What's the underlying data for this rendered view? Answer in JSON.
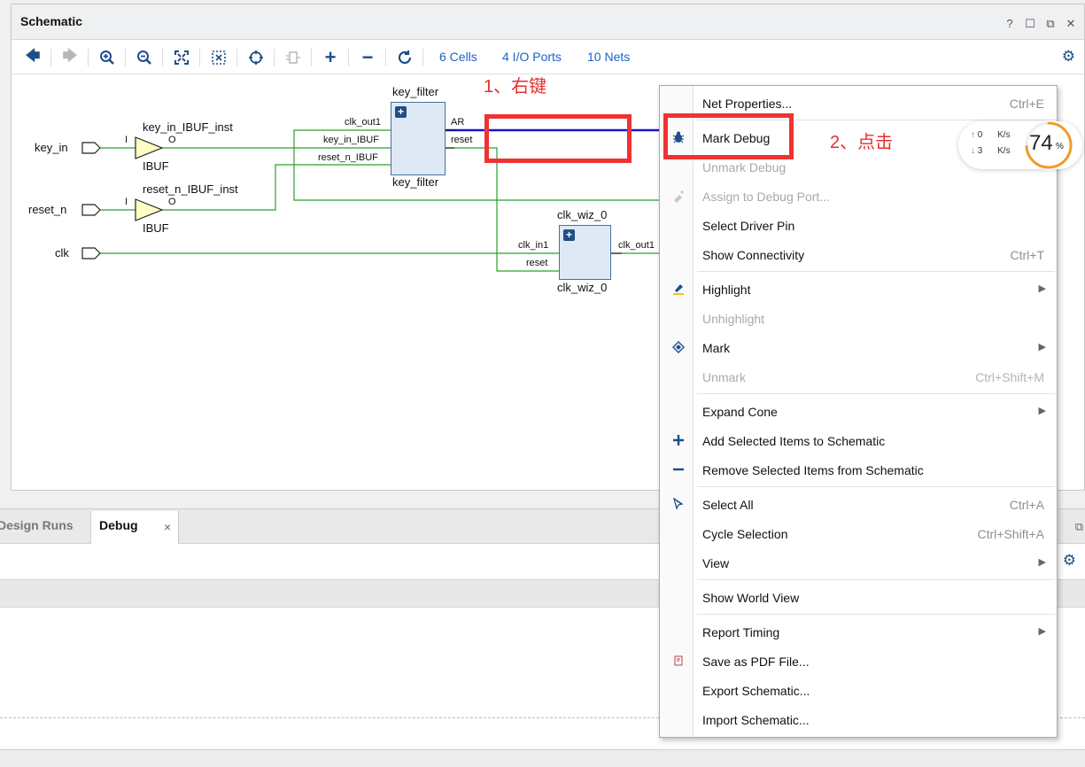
{
  "schematic": {
    "title": "Schematic",
    "links": {
      "cells": "6 Cells",
      "io_ports": "4 I/O Ports",
      "nets": "10 Nets"
    },
    "ports": [
      "key_in",
      "reset_n",
      "clk"
    ],
    "ibuf1": {
      "inst": "key_in_IBUF_inst",
      "type": "IBUF",
      "pin_i": "I",
      "pin_o": "O"
    },
    "ibuf2": {
      "inst": "reset_n_IBUF_inst",
      "type": "IBUF",
      "pin_i": "I",
      "pin_o": "O"
    },
    "key_filter": {
      "name_top": "key_filter",
      "name_bottom": "key_filter",
      "pins_in": [
        "clk_out1",
        "key_in_IBUF",
        "reset_n_IBUF"
      ],
      "pins_out": [
        "AR",
        "reset"
      ]
    },
    "clk_wiz": {
      "name_top": "clk_wiz_0",
      "name_bottom": "clk_wiz_0",
      "pins_in": [
        "clk_in1",
        "reset"
      ],
      "pin_out": "clk_out1"
    },
    "annotations": {
      "step1": "1、右键",
      "step2": "2、点击"
    }
  },
  "context_menu": {
    "items": [
      {
        "label": "Net Properties...",
        "shortcut": "Ctrl+E",
        "disabled": false,
        "icon": ""
      },
      {
        "label": "Mark Debug",
        "shortcut": "",
        "disabled": false,
        "icon": "bug-icon"
      },
      {
        "label": "Unmark Debug",
        "shortcut": "",
        "disabled": true,
        "icon": ""
      },
      {
        "label": "Assign to Debug Port...",
        "shortcut": "",
        "disabled": true,
        "icon": "probe-icon"
      },
      {
        "label": "Select Driver Pin",
        "shortcut": "",
        "disabled": false,
        "icon": ""
      },
      {
        "label": "Show Connectivity",
        "shortcut": "Ctrl+T",
        "disabled": false,
        "icon": ""
      },
      {
        "label": "Highlight",
        "shortcut": "",
        "disabled": false,
        "icon": "highlight-icon",
        "submenu": true
      },
      {
        "label": "Unhighlight",
        "shortcut": "",
        "disabled": true,
        "icon": ""
      },
      {
        "label": "Mark",
        "shortcut": "",
        "disabled": false,
        "icon": "mark-icon",
        "submenu": true
      },
      {
        "label": "Unmark",
        "shortcut": "Ctrl+Shift+M",
        "disabled": true,
        "icon": ""
      },
      {
        "label": "Expand Cone",
        "shortcut": "",
        "disabled": false,
        "icon": "",
        "submenu": true
      },
      {
        "label": "Add Selected Items to Schematic",
        "shortcut": "",
        "disabled": false,
        "icon": "plus-icon"
      },
      {
        "label": "Remove Selected Items from Schematic",
        "shortcut": "",
        "disabled": false,
        "icon": "minus-icon"
      },
      {
        "label": "Select All",
        "shortcut": "Ctrl+A",
        "disabled": false,
        "icon": "select-all-icon"
      },
      {
        "label": "Cycle Selection",
        "shortcut": "Ctrl+Shift+A",
        "disabled": false,
        "icon": ""
      },
      {
        "label": "View",
        "shortcut": "",
        "disabled": false,
        "icon": "",
        "submenu": true
      },
      {
        "label": "Show World View",
        "shortcut": "",
        "disabled": false,
        "icon": ""
      },
      {
        "label": "Report Timing",
        "shortcut": "",
        "disabled": false,
        "icon": "",
        "submenu": true
      },
      {
        "label": "Save as PDF File...",
        "shortcut": "",
        "disabled": false,
        "icon": "pdf-icon"
      },
      {
        "label": "Export Schematic...",
        "shortcut": "",
        "disabled": false,
        "icon": ""
      },
      {
        "label": "Import Schematic...",
        "shortcut": "",
        "disabled": false,
        "icon": ""
      }
    ]
  },
  "bottom_tabs": {
    "design_runs": "Design Runs",
    "debug": "Debug"
  },
  "speed_widget": {
    "up_value": "0",
    "down_value": "3",
    "unit": "K/s",
    "percent": "74",
    "percent_sign": "%"
  },
  "colors": {
    "wire": "#2aa12a",
    "selected_net": "#1414c8",
    "annotation": "#e53030",
    "link": "#1a62c8"
  }
}
